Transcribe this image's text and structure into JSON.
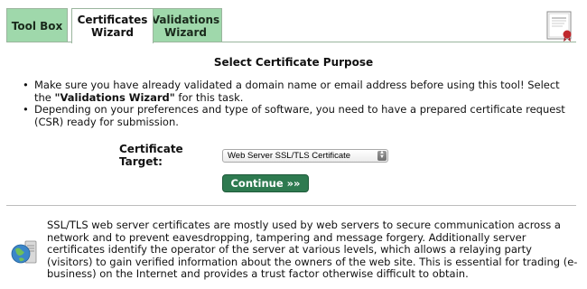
{
  "tabs": [
    {
      "label": "Tool Box"
    },
    {
      "label_line1": "Certificates",
      "label_line2": "Wizard"
    },
    {
      "label_line1": "Validations",
      "label_line2": "Wizard"
    }
  ],
  "heading": "Select Certificate Purpose",
  "bullets": {
    "first_prefix": "Make sure you have already validated a domain name or email address before using this tool! Select the ",
    "first_link": "\"Validations Wizard\"",
    "first_suffix": " for this task.",
    "second": "Depending on your preferences and type of software, you need to have a prepared certificate request (CSR) ready for submission."
  },
  "target": {
    "label": "Certificate Target:",
    "selected": "Web Server SSL/TLS Certificate"
  },
  "continue_label": "Continue »»",
  "description": "SSL/TLS web server certificates are mostly used by web servers to secure communication across a network and to prevent eavesdropping, tampering and message forgery. Additionally server certificates identify the operator of the server at various levels, which allows a relaying party (visitors) to gain verified information about the owners of the web site. This is essential for trading (e-business) on the Internet and provides a trust factor otherwise difficult to obtain.",
  "colors": {
    "tab_green": "#9fd8ab",
    "button_green": "#2e7a50",
    "tab_border": "#9ab59d"
  },
  "icons": [
    "certificate-icon",
    "globe-server-icon",
    "select-arrows-icon"
  ]
}
